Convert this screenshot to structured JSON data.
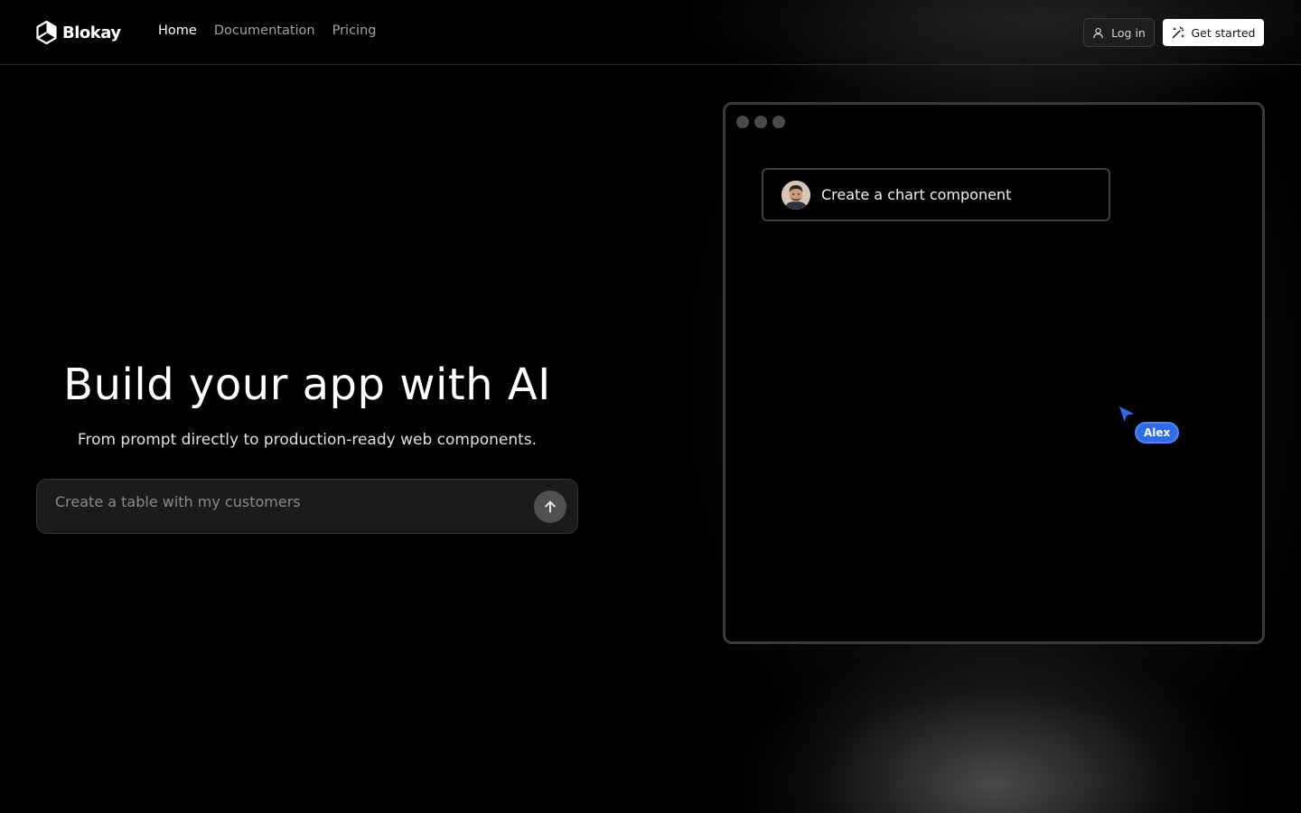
{
  "brand": {
    "name": "Blokay"
  },
  "nav": {
    "items": [
      {
        "label": "Home",
        "active": true
      },
      {
        "label": "Documentation",
        "active": false
      },
      {
        "label": "Pricing",
        "active": false
      }
    ]
  },
  "header_actions": {
    "login_label": "Log in",
    "get_started_label": "Get started"
  },
  "hero": {
    "title": "Build your app with AI",
    "subtitle": "From prompt directly to production-ready web components.",
    "prompt_placeholder": "Create a table with my customers"
  },
  "preview": {
    "chat_message": "Create a chart component",
    "cursor_user": "Alex"
  },
  "colors": {
    "background": "#000000",
    "accent_blue": "#2f6be8",
    "button_light": "#ffffff"
  },
  "icons": {
    "logo": "blokay-hex-logo",
    "login": "user-icon",
    "get_started": "magic-wand-icon",
    "send": "arrow-up-icon",
    "cursor": "pointer-arrow-icon"
  }
}
